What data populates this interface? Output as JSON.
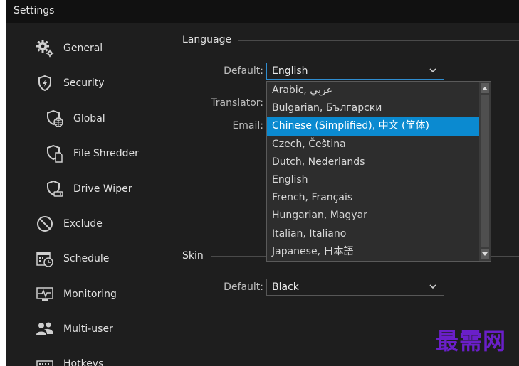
{
  "window": {
    "title": "Settings"
  },
  "sidebar": {
    "items": [
      {
        "label": "General",
        "icon": "gears-icon"
      },
      {
        "label": "Security",
        "icon": "shield-icon"
      },
      {
        "label": "Global",
        "icon": "shield-globe-icon"
      },
      {
        "label": "File Shredder",
        "icon": "shield-file-icon"
      },
      {
        "label": "Drive Wiper",
        "icon": "shield-drive-icon"
      },
      {
        "label": "Exclude",
        "icon": "prohibited-icon"
      },
      {
        "label": "Schedule",
        "icon": "calendar-clock-icon"
      },
      {
        "label": "Monitoring",
        "icon": "monitor-pulse-icon"
      },
      {
        "label": "Multi-user",
        "icon": "users-icon"
      },
      {
        "label": "Hotkeys",
        "icon": "keyboard-icon"
      }
    ]
  },
  "language": {
    "group_title": "Language",
    "default_label": "Default:",
    "default_value": "English",
    "translator_label": "Translator:",
    "email_label": "Email:",
    "options": [
      "Arabic, عربي",
      "Bulgarian, Български",
      "Chinese (Simplified), 中文 (简体)",
      "Czech, Čeština",
      "Dutch, Nederlands",
      "English",
      "French, Français",
      "Hungarian, Magyar",
      "Italian, Italiano",
      "Japanese, 日本語"
    ],
    "highlighted_option": "Chinese (Simplified), 中文 (简体)"
  },
  "skin": {
    "group_title": "Skin",
    "default_label": "Default:",
    "default_value": "Black"
  },
  "watermark": "最需网",
  "colors": {
    "accent": "#0b8ad0",
    "focus_border": "#2f8dd0",
    "background": "#1e1e1e",
    "watermark": "#6a1fc9"
  }
}
